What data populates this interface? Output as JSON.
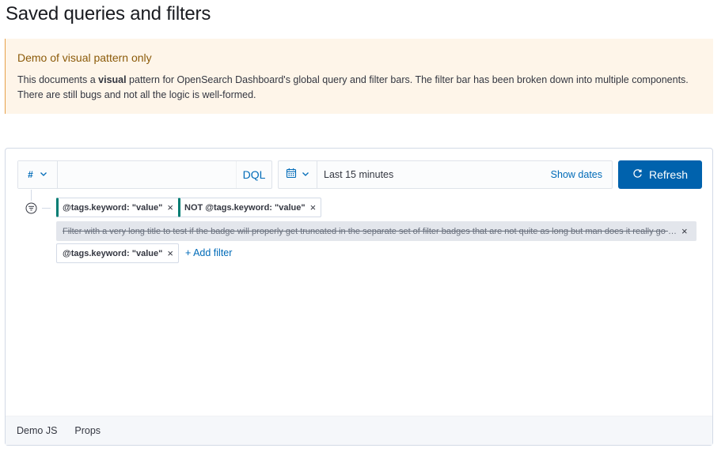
{
  "page": {
    "title": "Saved queries and filters"
  },
  "callout": {
    "title": "Demo of visual pattern only",
    "body_before": "This documents a ",
    "body_bold": "visual",
    "body_after": " pattern for OpenSearch Dashboard's global query and filter bars. The filter bar has been broken down into multiple components. There are still bugs and not all the logic is well-formed."
  },
  "query_bar": {
    "language_symbol": "#",
    "query_value": "",
    "language": "DQL",
    "date_range": "Last 15 minutes",
    "show_dates": "Show dates",
    "refresh": "Refresh"
  },
  "filters": {
    "items": [
      {
        "label": "@tags.keyword: \"value\"",
        "pinned": true,
        "disabled": false
      },
      {
        "label": "NOT @tags.keyword: \"value\"",
        "pinned": true,
        "disabled": false
      },
      {
        "label": "Filter with a very long title to test if the badge will properly get truncated in the separate set of filter badges that are not quite as long but man does it really go on forever",
        "pinned": false,
        "disabled": true
      },
      {
        "label": "@tags.keyword: \"value\"",
        "pinned": false,
        "disabled": false
      }
    ],
    "remove_symbol": "×",
    "add_filter": "+ Add filter"
  },
  "tabs": [
    {
      "label": "Demo JS"
    },
    {
      "label": "Props"
    }
  ],
  "colors": {
    "primary": "#006bb8",
    "refresh_bg": "#0062ad",
    "pinned": "#017d73",
    "callout_bg": "#fef5e9",
    "callout_title": "#8c5b0a"
  }
}
